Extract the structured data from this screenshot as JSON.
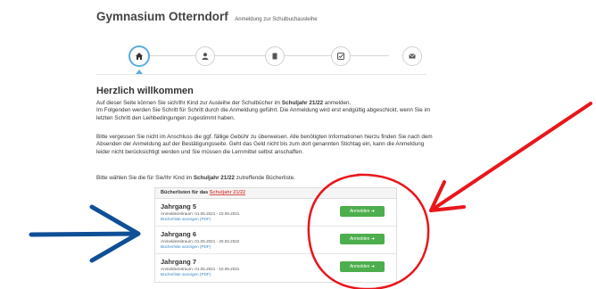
{
  "header": {
    "title": "Gymnasium Otterndorf",
    "subtitle": "Anmeldung zur Schulbuchausleihe"
  },
  "steps": [
    {
      "icon": "home-icon",
      "active": true
    },
    {
      "icon": "user-icon",
      "active": false
    },
    {
      "icon": "book-icon",
      "active": false
    },
    {
      "icon": "check-icon",
      "active": false
    },
    {
      "icon": "envelope-icon",
      "active": false
    }
  ],
  "main": {
    "heading": "Herzlich willkommen",
    "p1_a": "Auf dieser Seite können Sie sich/Ihr Kind zur Ausleihe der Schulbücher im ",
    "p1_b": "Schuljahr 21/22",
    "p1_c": " anmelden.",
    "p1_d": "Im Folgenden werden Sie Schritt für Schritt durch die Anmeldung geführt. Die Anmeldung wird erst endgültig abgeschickt, wenn Sie im letzten Schritt den Leihbedingungen zugestimmt haben.",
    "p2": "Bitte vergessen Sie nicht im Anschluss die ggf. fällige Gebühr zu überweisen. Alle benötigten Informationen hierzu finden Sie nach dem Absenden der Anmeldung auf der Bestätigungsseite. Geht das Geld nicht bis zum dort genannten Stichtag ein, kann die Anmeldung leider nicht berücksichtigt werden und Sie müssen die Lernmittel selbst anschaffen.",
    "p3_a": "Bitte wählen Sie die für Sie/Ihr Kind im ",
    "p3_b": "Schuljahr 21/22",
    "p3_c": " zutreffende Bücherliste."
  },
  "panel": {
    "heading_prefix": "Bücherlisten für das ",
    "heading_link": "Schuljahr 21/22",
    "rows": [
      {
        "title": "Jahrgang 5",
        "period": "Anmeldezeitraum: 01.05.2021 - 10.09.2021",
        "pdf": "Bücherliste anzeigen (PDF)",
        "button": "Anmelden ➜"
      },
      {
        "title": "Jahrgang 6",
        "period": "Anmeldezeitraum: 01.05.2021 - 20.03.2022",
        "pdf": "Bücherliste anzeigen (PDF)",
        "button": "Anmelden ➜"
      },
      {
        "title": "Jahrgang 7",
        "period": "Anmeldezeitraum: 01.05.2021 - 10.09.2021",
        "pdf": "Bücherliste anzeigen (PDF)",
        "button": "Anmelden ➜"
      }
    ]
  },
  "colors": {
    "accent": "#5aaedc",
    "button": "#4cae4c",
    "link_red": "#d9534f",
    "annotation_red": "#e8161b",
    "annotation_blue": "#0f4f96"
  }
}
